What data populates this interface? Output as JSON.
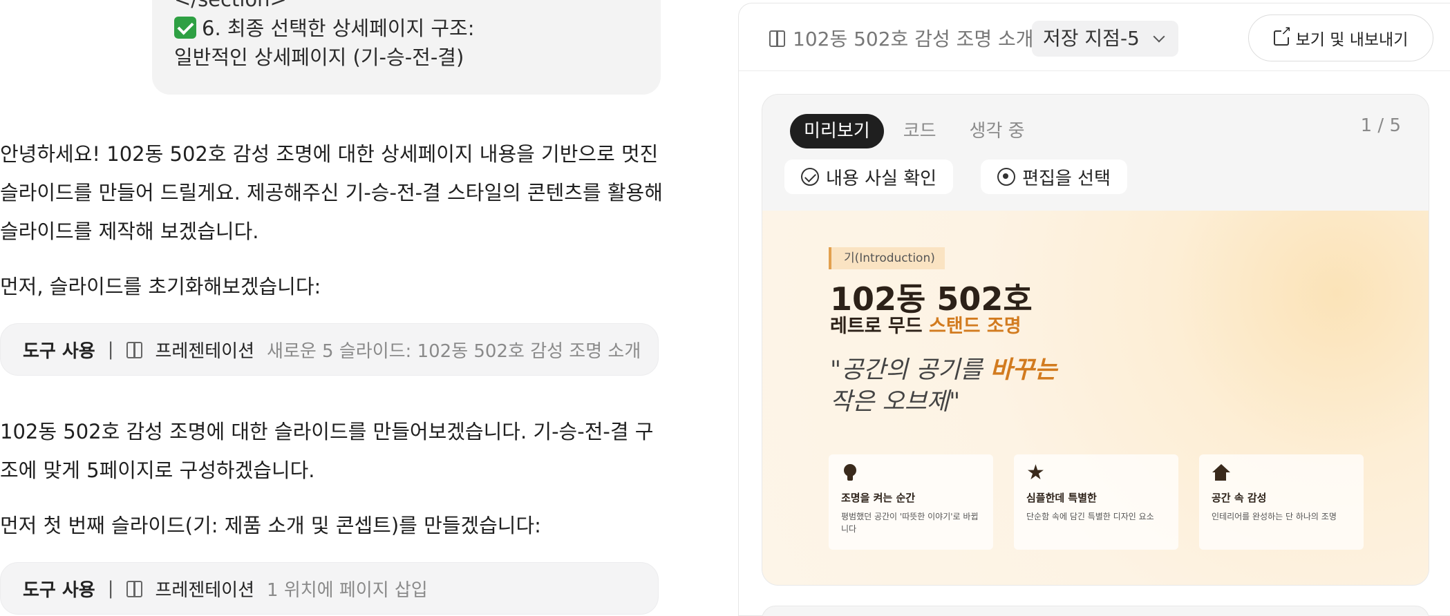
{
  "chat": {
    "user_bubble": {
      "line0": "</section>",
      "line1": "6. 최종 선택한 상세페이지 구조:",
      "line2": "일반적인 상세페이지 (기-승-전-결)"
    },
    "para1": "안녕하세요! 102동 502호 감성 조명에 대한 상세페이지 내용을 기반으로 멋진 슬라이드를 만들어 드릴게요. 제공해주신 기-승-전-결 스타일의 콘텐츠를 활용해 슬라이드를 제작해 보겠습니다.",
    "para2": "먼저, 슬라이드를 초기화해보겠습니다:",
    "tool1": {
      "label": "도구 사용",
      "sep": "|",
      "name": "프레젠테이션",
      "detail": "새로운 5 슬라이드: 102동 502호 감성 조명 소개"
    },
    "para3": "102동 502호 감성 조명에 대한 슬라이드를 만들어보겠습니다. 기-승-전-결 구조에 맞게 5페이지로 구성하겠습니다.",
    "para4": "먼저 첫 번째 슬라이드(기: 제품 소개 및 콘셉트)를 만들겠습니다:",
    "tool2": {
      "label": "도구 사용",
      "sep": "|",
      "name": "프레젠테이션",
      "detail": "1 위치에 페이지 삽입"
    }
  },
  "panel": {
    "title": "102동 502호 감성 조명 소개",
    "save_point": "저장 지점-5",
    "export_label": "보기 및 내보내기",
    "tabs": [
      "미리보기",
      "코드",
      "생각 중"
    ],
    "page_count": "1 / 5",
    "actions": {
      "fact_check": "내용 사실 확인",
      "select_edit": "편집을 선택"
    }
  },
  "slide": {
    "badge": "기(Introduction)",
    "title": "102동 502호",
    "subtitle_plain": "레트로 무드 ",
    "subtitle_highlight": "스탠드 조명",
    "quote_line1_plain": "\"공간의 공기를 ",
    "quote_line1_highlight": "바꾸는",
    "quote_line2": "작은 오브제\"",
    "features": [
      {
        "icon": "lightbulb-icon",
        "title": "조명을 켜는 순간",
        "desc": "평범했던 공간이 '따뜻한 이야기'로 바뀝니다"
      },
      {
        "icon": "star-icon",
        "title": "심플한데 특별한",
        "desc": "단순함 속에 담긴 특별한 디자인 요소"
      },
      {
        "icon": "home-icon",
        "title": "공간 속 감성",
        "desc": "인테리어를 완성하는 단 하나의 조명"
      }
    ]
  },
  "colors": {
    "accent": "#d27b1f",
    "slide_bg": "#fdf3e4",
    "dark_text": "#2c2118",
    "check_green": "#2ea043"
  }
}
